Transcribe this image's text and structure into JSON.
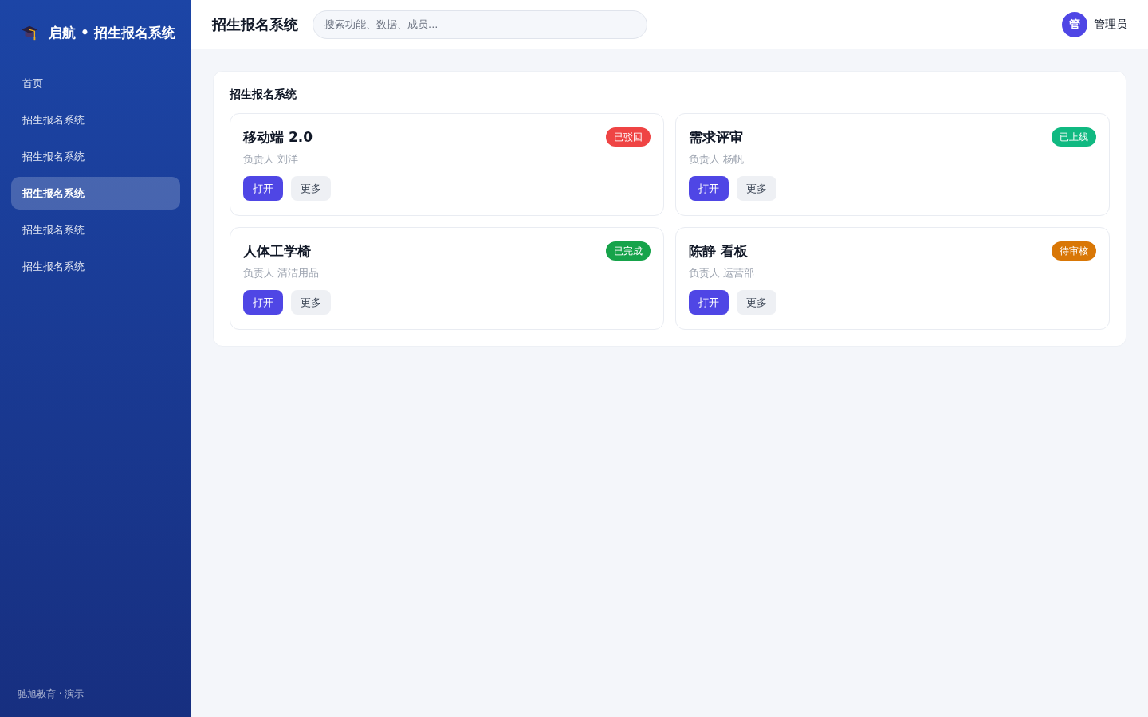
{
  "sidebar": {
    "brand": "启航 • 招生报名系统",
    "items": [
      {
        "label": "首页",
        "selected": false
      },
      {
        "label": "招生报名系统",
        "selected": false
      },
      {
        "label": "招生报名系统",
        "selected": false
      },
      {
        "label": "招生报名系统",
        "selected": true
      },
      {
        "label": "招生报名系统",
        "selected": false
      },
      {
        "label": "招生报名系统",
        "selected": false
      }
    ],
    "footer": "驰旭教育 · 演示"
  },
  "header": {
    "title": "招生报名系统",
    "search": {
      "placeholder": "搜索功能、数据、成员..."
    },
    "user": {
      "avatar": "管",
      "name": "管理员"
    }
  },
  "panel": {
    "title": "招生报名系统",
    "cards": [
      {
        "title": "移动端 2.0",
        "status": "已驳回",
        "color": "#ef4444",
        "owner": "负责人 刘洋",
        "buttons": [
          {
            "label": "打开",
            "kind": "primary"
          },
          {
            "label": "更多",
            "kind": "secondary"
          }
        ]
      },
      {
        "title": "需求评审",
        "status": "已上线",
        "color": "#10b981",
        "owner": "负责人 杨帆",
        "buttons": [
          {
            "label": "打开",
            "kind": "primary"
          },
          {
            "label": "更多",
            "kind": "secondary"
          }
        ]
      },
      {
        "title": "人体工学椅",
        "status": "已完成",
        "color": "#16a34a",
        "owner": "负责人 清洁用品",
        "buttons": [
          {
            "label": "打开",
            "kind": "primary"
          },
          {
            "label": "更多",
            "kind": "secondary"
          }
        ]
      },
      {
        "title": "陈静 看板",
        "status": "待审核",
        "color": "#d97706",
        "owner": "负责人 运营部",
        "buttons": [
          {
            "label": "打开",
            "kind": "primary"
          },
          {
            "label": "更多",
            "kind": "secondary"
          }
        ]
      }
    ]
  }
}
